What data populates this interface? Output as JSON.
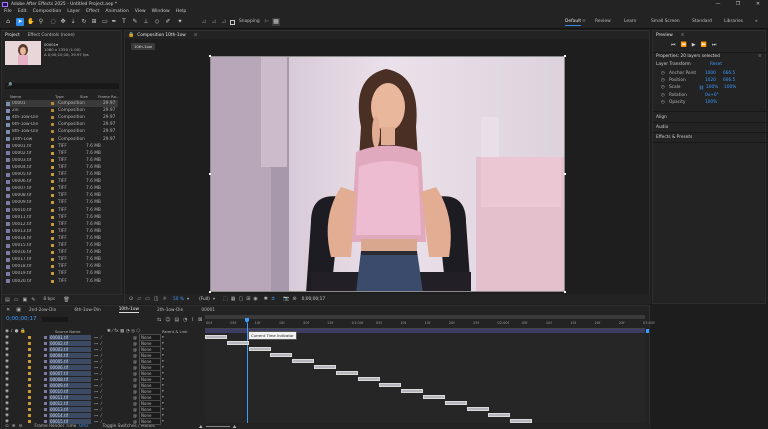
{
  "window": {
    "title": "Adobe After Effects 2025 - Untitled Project.aep *",
    "controls": [
      "—",
      "❐",
      "✕"
    ]
  },
  "menu": [
    "File",
    "Edit",
    "Composition",
    "Layer",
    "Effect",
    "Animation",
    "View",
    "Window",
    "Help"
  ],
  "toolbar": {
    "snapping_label": "Snapping",
    "workspaces": [
      "Default",
      "Review",
      "Learn",
      "Small Screen",
      "Standard",
      "Libraries"
    ]
  },
  "project": {
    "tabs": [
      "Project",
      "Effect Controls (none)"
    ],
    "selected_item": {
      "name": "00001▾",
      "line1": "1080 x 1350 (1.00)",
      "line2": "Δ 0;00;10;18, 29.97 fps"
    },
    "search_placeholder": "🔎",
    "columns": [
      "Name",
      "Type",
      "Size",
      "Frame Ra..."
    ],
    "items": [
      {
        "name": "00001",
        "type": "Composition",
        "size": "",
        "fps": "29.97",
        "comp": true
      },
      {
        "name": "2in",
        "type": "Composition",
        "size": "",
        "fps": "29.97",
        "comp": true
      },
      {
        "name": "4th-1ow-Din",
        "type": "Composition",
        "size": "",
        "fps": "29.97",
        "comp": true
      },
      {
        "name": "6th-1ow-Din",
        "type": "Composition",
        "size": "",
        "fps": "29.97",
        "comp": true
      },
      {
        "name": "8th-1ow-Din",
        "type": "Composition",
        "size": "",
        "fps": "29.97",
        "comp": true
      },
      {
        "name": "10th-1ow",
        "type": "Composition",
        "size": "",
        "fps": "29.97",
        "comp": true
      },
      {
        "name": "00001.tif",
        "type": "TIFF",
        "size": "7.6 MB",
        "fps": "",
        "comp": false
      },
      {
        "name": "00002.tif",
        "type": "TIFF",
        "size": "7.6 MB",
        "fps": "",
        "comp": false
      },
      {
        "name": "00003.tif",
        "type": "TIFF",
        "size": "7.6 MB",
        "fps": "",
        "comp": false
      },
      {
        "name": "00004.tif",
        "type": "TIFF",
        "size": "7.6 MB",
        "fps": "",
        "comp": false
      },
      {
        "name": "00005.tif",
        "type": "TIFF",
        "size": "7.6 MB",
        "fps": "",
        "comp": false
      },
      {
        "name": "00006.tif",
        "type": "TIFF",
        "size": "7.6 MB",
        "fps": "",
        "comp": false
      },
      {
        "name": "00007.tif",
        "type": "TIFF",
        "size": "7.6 MB",
        "fps": "",
        "comp": false
      },
      {
        "name": "00008.tif",
        "type": "TIFF",
        "size": "7.6 MB",
        "fps": "",
        "comp": false
      },
      {
        "name": "00009.tif",
        "type": "TIFF",
        "size": "7.6 MB",
        "fps": "",
        "comp": false
      },
      {
        "name": "00010.tif",
        "type": "TIFF",
        "size": "7.6 MB",
        "fps": "",
        "comp": false
      },
      {
        "name": "00011.tif",
        "type": "TIFF",
        "size": "7.6 MB",
        "fps": "",
        "comp": false
      },
      {
        "name": "00012.tif",
        "type": "TIFF",
        "size": "7.6 MB",
        "fps": "",
        "comp": false
      },
      {
        "name": "00013.tif",
        "type": "TIFF",
        "size": "7.6 MB",
        "fps": "",
        "comp": false
      },
      {
        "name": "00014.tif",
        "type": "TIFF",
        "size": "7.6 MB",
        "fps": "",
        "comp": false
      },
      {
        "name": "00015.tif",
        "type": "TIFF",
        "size": "7.6 MB",
        "fps": "",
        "comp": false
      },
      {
        "name": "00016.tif",
        "type": "TIFF",
        "size": "7.6 MB",
        "fps": "",
        "comp": false
      },
      {
        "name": "00017.tif",
        "type": "TIFF",
        "size": "7.6 MB",
        "fps": "",
        "comp": false
      },
      {
        "name": "00018.tif",
        "type": "TIFF",
        "size": "7.6 MB",
        "fps": "",
        "comp": false
      },
      {
        "name": "00019.tif",
        "type": "TIFF",
        "size": "7.6 MB",
        "fps": "",
        "comp": false
      },
      {
        "name": "00020.tif",
        "type": "TIFF",
        "size": "7.6 MB",
        "fps": "",
        "comp": false
      }
    ],
    "footer_bpc": "8 bpc"
  },
  "composition": {
    "tab_label": "Composition 10th-1ow",
    "breadcrumb": "10th-1ow",
    "zoom": "50 %",
    "resolution": "(Full)",
    "timecode": "0;00;00;17"
  },
  "right_panel": {
    "preview_title": "Preview",
    "properties_title": "Properties: 20 layers selected",
    "layer_transform": "Layer Transform",
    "reset": "Reset",
    "props": [
      {
        "name": "Anchor Point",
        "v1": "1000",
        "v2": "666.5"
      },
      {
        "name": "Position",
        "v1": "1020",
        "v2": "666.5"
      },
      {
        "name": "Scale",
        "v1": "100%",
        "v2": "100%"
      },
      {
        "name": "Rotation",
        "v1": "0x+0°",
        "v2": ""
      },
      {
        "name": "Opacity",
        "v1": "100%",
        "v2": ""
      }
    ],
    "sections": [
      "Align",
      "Audio",
      "Effects & Presets"
    ]
  },
  "timeline": {
    "tabs": [
      "2nd-2ow-Din",
      "6th-1ow-Din",
      "10th-1ow",
      "2th-1ow-Din",
      "00001"
    ],
    "active_tab": 2,
    "timecode": "0;00;00;17",
    "col_source": "Source Name",
    "col_parent": "Parent & Link",
    "ruler_ticks": [
      "00f",
      "05f",
      "10f",
      "15f",
      "20f",
      "25f",
      "01:00f",
      "05f",
      "10f",
      "15f",
      "20f",
      "25f",
      "02:00f",
      "05f",
      "10f",
      "15f",
      "20f",
      "25f",
      "03:00f"
    ],
    "tooltip": "Current Time Indicator",
    "parent_value": "None",
    "layers": [
      "00001.tif",
      "00002.tif",
      "00003.tif",
      "00004.tif",
      "00005.tif",
      "00006.tif",
      "00007.tif",
      "00008.tif",
      "00009.tif",
      "00010.tif",
      "00011.tif",
      "00012.tif",
      "00013.tif",
      "00014.tif",
      "00015.tif"
    ],
    "footer_left": "Frame Render Time",
    "footer_render": "0ms",
    "footer_mid": "Toggle Switches / Modes"
  },
  "colors": {
    "accent": "#2d8ceb",
    "panel_bg": "#232323",
    "app_bg": "#1d1d1d",
    "value_blue": "#3c9bff",
    "label_tan": "#c49a3b",
    "layer_bar": "#b6b6bd",
    "track_matte": "#3d3d63"
  }
}
